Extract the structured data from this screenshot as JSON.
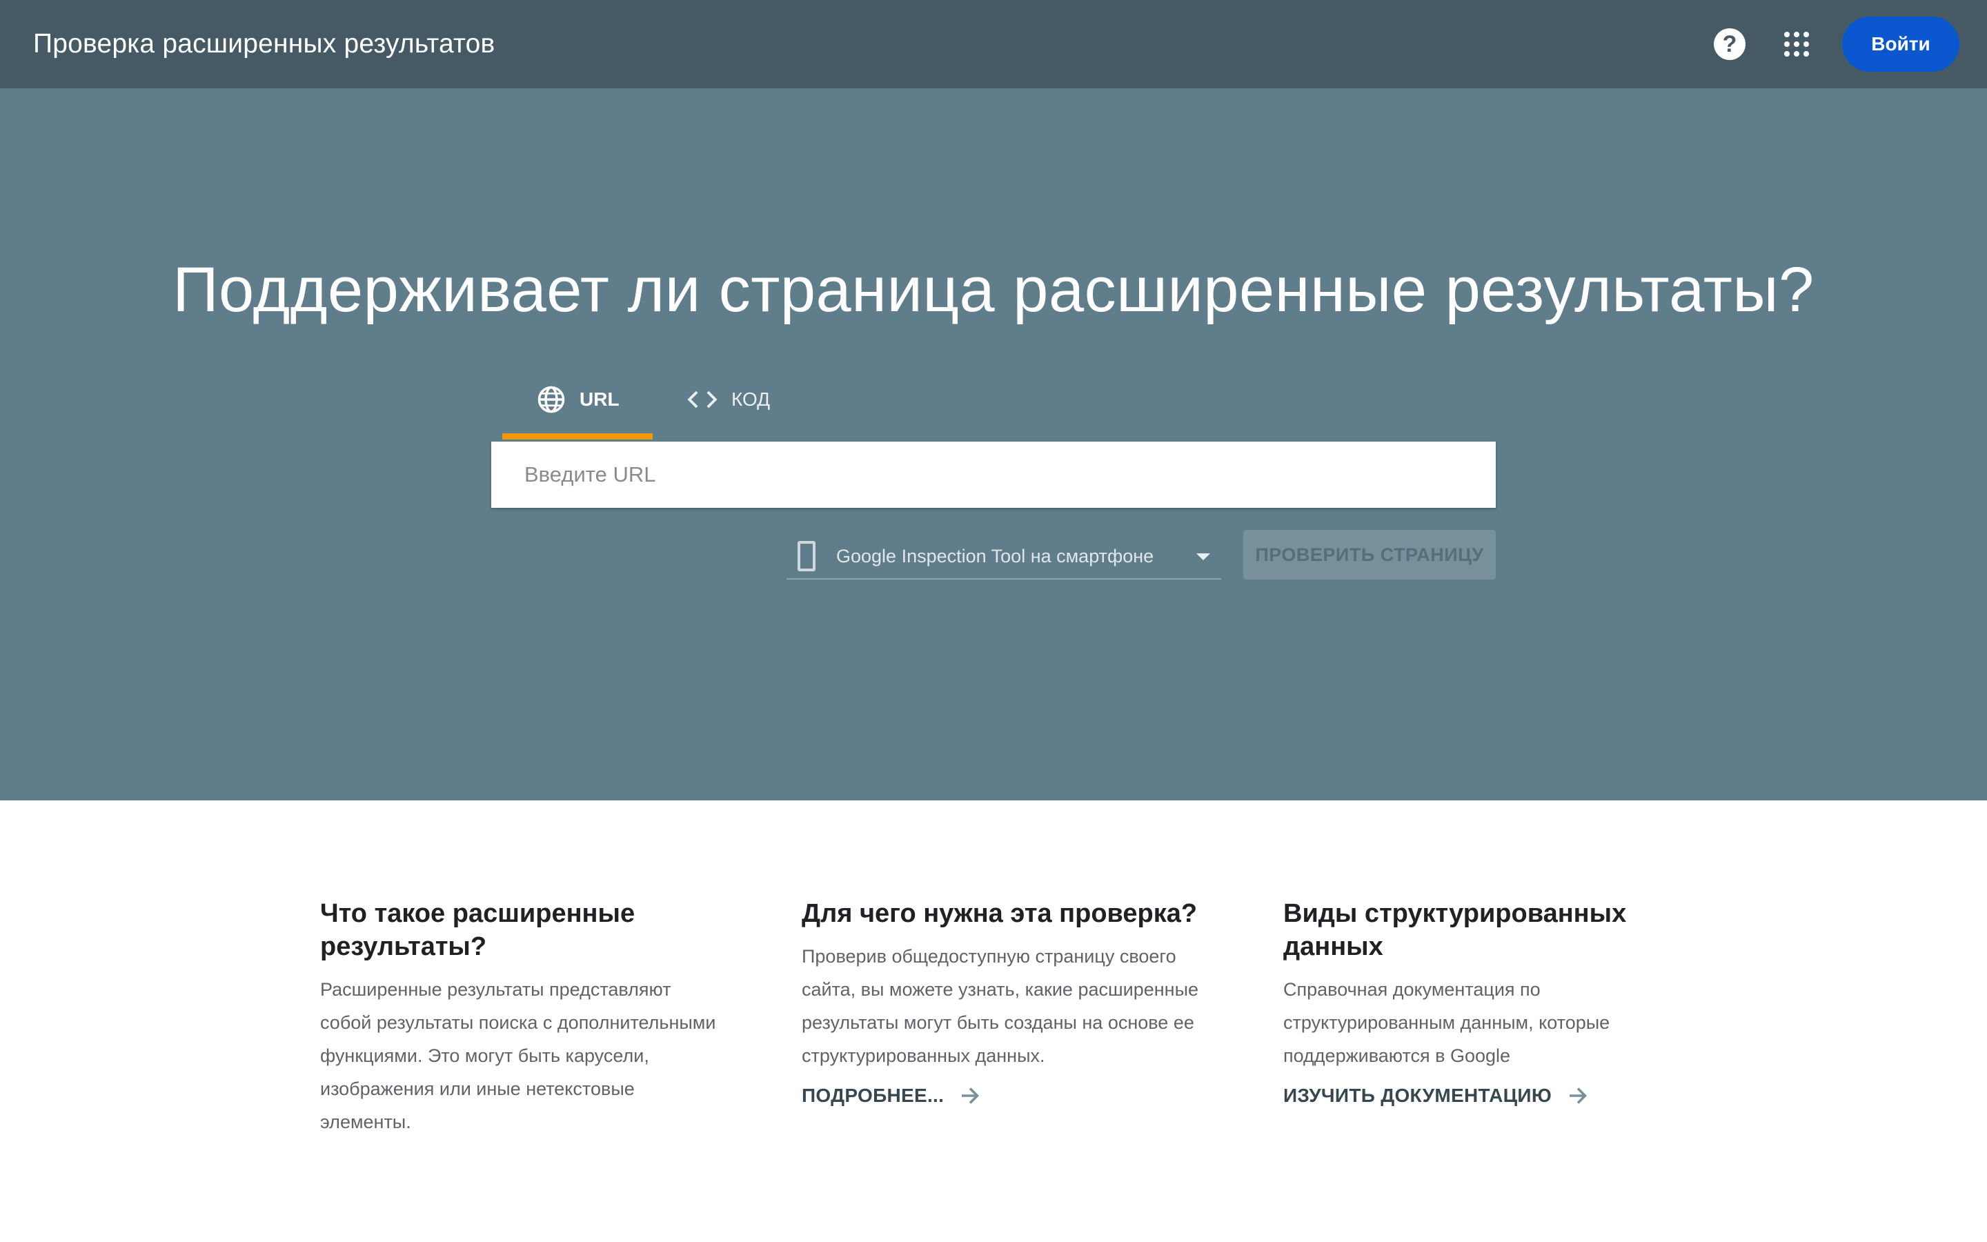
{
  "header": {
    "title": "Проверка расширенных результатов",
    "help_icon": "help-circle-icon",
    "apps_icon": "apps-grid-icon",
    "signin_label": "Войти",
    "signin_color": "#0b57d0"
  },
  "hero": {
    "title": "Поддерживает ли страница расширенные результаты?",
    "background": "#607d8b",
    "tabs": [
      {
        "label": "URL",
        "icon": "globe-icon",
        "selected": true
      },
      {
        "label": "КОД",
        "icon": "code-icon",
        "selected": false
      }
    ],
    "tab_indicator_color": "#f29900",
    "url_input": {
      "placeholder": "Введите URL",
      "value": ""
    },
    "agent_select": {
      "icon": "smartphone-icon",
      "value": "Google Inspection Tool на смартфоне"
    },
    "test_button_label": "ПРОВЕРИТЬ СТРАНИЦУ"
  },
  "info": [
    {
      "title": "Что такое расширенные результаты?",
      "text": "Расширенные результаты представляют собой результаты поиска с дополнительными функциями. Это могут быть карусели, изображения или иные нетекстовые элементы.",
      "link": ""
    },
    {
      "title": "Для чего нужна эта проверка?",
      "text": "Проверив общедоступную страницу своего сайта, вы можете узнать, какие расширенные результаты могут быть созданы на основе ее структурированных данных.",
      "link": "ПОДРОБНЕЕ..."
    },
    {
      "title": "Виды структурированных данных",
      "text": "Справочная документация по структурированным данным, которые поддерживаются в Google",
      "link": "ИЗУЧИТЬ ДОКУМЕНТАЦИЮ"
    }
  ]
}
